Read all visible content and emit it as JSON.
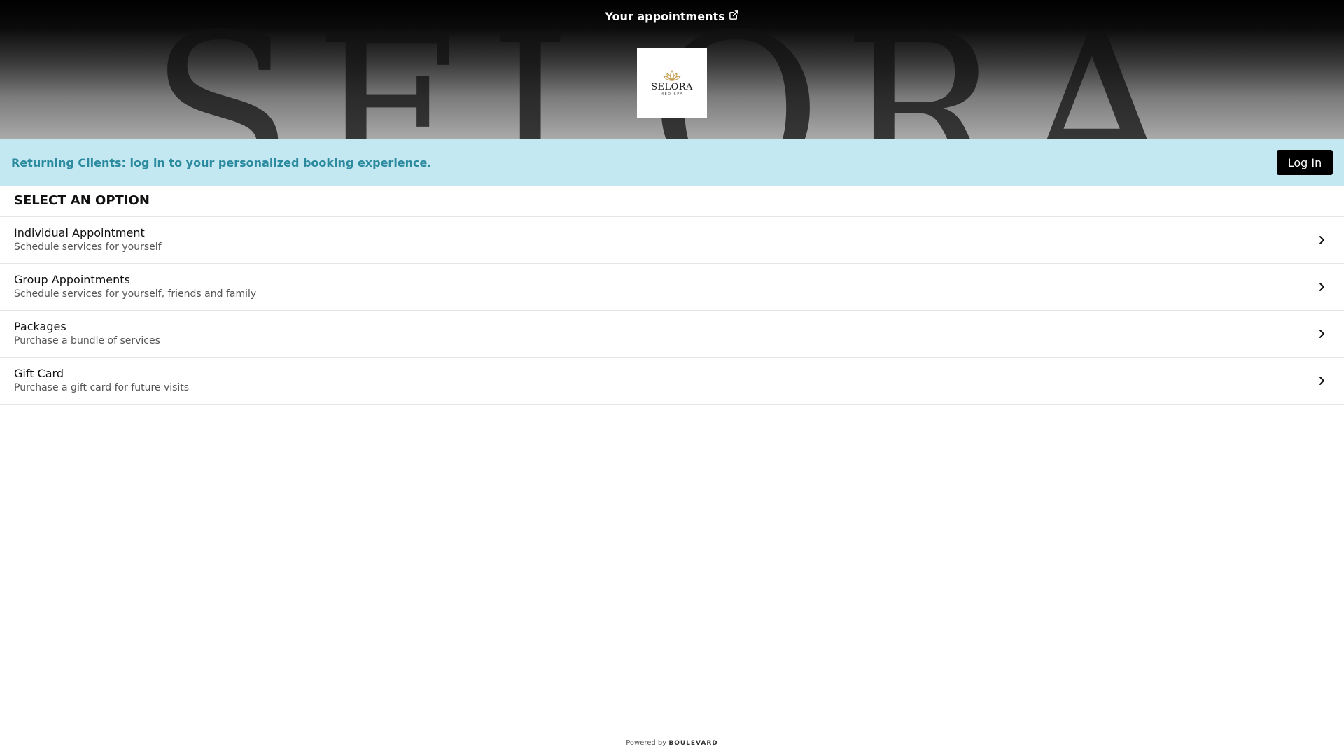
{
  "header": {
    "appointments_link": "Your appointments",
    "watermark_text": "SELORA",
    "logo": {
      "name": "SELORA",
      "subtitle": "MED SPA"
    }
  },
  "banner": {
    "message": "Returning Clients: log in to your personalized booking experience.",
    "login_label": "Log In"
  },
  "section": {
    "title": "SELECT AN OPTION",
    "options": [
      {
        "title": "Individual Appointment",
        "description": "Schedule services for yourself"
      },
      {
        "title": "Group Appointments",
        "description": "Schedule services for yourself, friends and family"
      },
      {
        "title": "Packages",
        "description": "Purchase a bundle of services"
      },
      {
        "title": "Gift Card",
        "description": "Purchase a gift card for future visits"
      }
    ]
  },
  "footer": {
    "powered_by": "Powered by",
    "brand": "BOULEVARD"
  },
  "colors": {
    "banner_bg": "#c3e8f1",
    "banner_text": "#2c8a9f",
    "button_bg": "#000000"
  },
  "icons": {
    "external_link": "external-link-icon",
    "chevron": "chevron-right-icon",
    "lotus": "lotus-icon"
  }
}
